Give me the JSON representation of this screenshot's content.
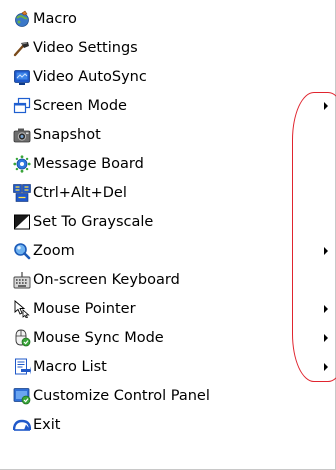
{
  "menu": {
    "items": [
      {
        "label": "Macro",
        "icon": "macro-icon",
        "submenu": false
      },
      {
        "label": "Video Settings",
        "icon": "video-settings-icon",
        "submenu": false
      },
      {
        "label": "Video AutoSync",
        "icon": "video-autosync-icon",
        "submenu": false
      },
      {
        "label": "Screen Mode",
        "icon": "screen-mode-icon",
        "submenu": true
      },
      {
        "label": "Snapshot",
        "icon": "camera-icon",
        "submenu": false
      },
      {
        "label": "Message Board",
        "icon": "message-board-icon",
        "submenu": false
      },
      {
        "label": "Ctrl+Alt+Del",
        "icon": "ctrl-alt-del-icon",
        "submenu": false
      },
      {
        "label": "Set To Grayscale",
        "icon": "grayscale-icon",
        "submenu": false
      },
      {
        "label": "Zoom",
        "icon": "magnifier-icon",
        "submenu": true
      },
      {
        "label": "On-screen Keyboard",
        "icon": "keyboard-icon",
        "submenu": false
      },
      {
        "label": "Mouse Pointer",
        "icon": "mouse-pointer-icon",
        "submenu": true
      },
      {
        "label": "Mouse Sync Mode",
        "icon": "mouse-sync-icon",
        "submenu": true
      },
      {
        "label": "Macro List",
        "icon": "macro-list-icon",
        "submenu": true
      },
      {
        "label": "Customize Control Panel",
        "icon": "customize-panel-icon",
        "submenu": false
      },
      {
        "label": "Exit",
        "icon": "exit-icon",
        "submenu": false
      }
    ]
  },
  "colors": {
    "annotation_oval": "#e0242e",
    "menu_background": "#ffffff",
    "text": "#000000"
  }
}
